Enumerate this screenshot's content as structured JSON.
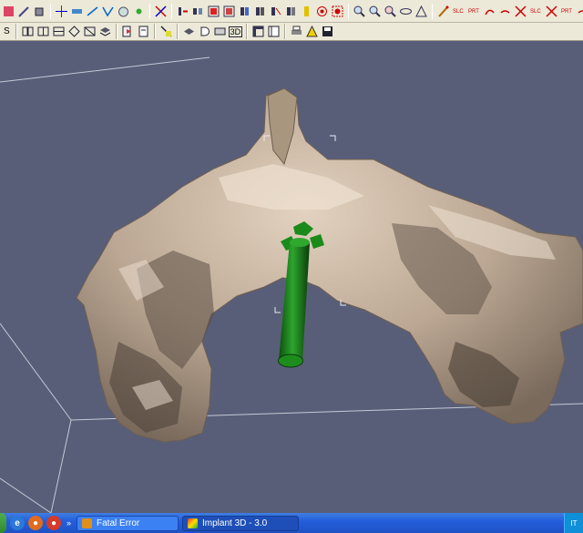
{
  "toolbar1": {
    "icons": [
      "toolbar-icon-a",
      "wand-icon",
      "cube-icon",
      "crosshair-icon",
      "ruler-icon",
      "measure-icon",
      "angle-icon",
      "hand-icon",
      "node-icon",
      "cut-icon",
      "implant-insert-icon",
      "implant-tool-icon",
      "view-front-icon",
      "view-side-icon",
      "view-top-icon",
      "view-3d-icon",
      "grid-icon",
      "marker-icon",
      "cylinder-icon",
      "target-icon",
      "target-red-icon",
      "zoom-in-icon",
      "zoom-out-icon",
      "zoom-fit-icon",
      "rotate-icon",
      "triangle-icon",
      "paint-icon",
      "pencil-icon",
      "eraser-icon",
      "cross-red-icon",
      "brush-icon",
      "brush-x-icon",
      "tooth-icon",
      "tooth-x-icon",
      "settings-icon"
    ]
  },
  "toolbar2": {
    "label_s": "S",
    "icons": [
      "slice-icon",
      "slice2-icon",
      "layers-icon",
      "layers2-icon",
      "axis-icon",
      "stack-icon",
      "play-icon",
      "doc-icon",
      "cut-plane-icon",
      "diamond-icon",
      "half-icon",
      "rect-icon",
      "view3d-icon",
      "frame-icon",
      "panel-icon",
      "print-icon",
      "warning-icon",
      "save-icon"
    ],
    "label_3d": "3D"
  },
  "taskbar": {
    "tasks": [
      {
        "label": "Fatal Error",
        "active": false
      },
      {
        "label": "Implant 3D - 3.0",
        "active": true
      }
    ],
    "tray_text": "IT"
  },
  "colors": {
    "background": "#585e78",
    "bone": "#bca995",
    "implant": "#137a13",
    "toolbar": "#ece9d8",
    "taskbar": "#245edb"
  }
}
